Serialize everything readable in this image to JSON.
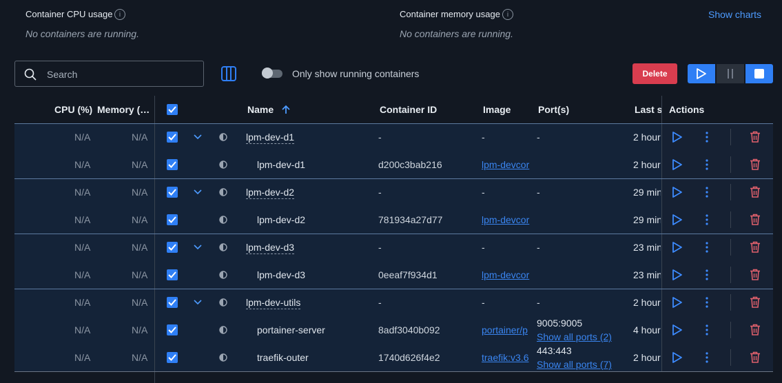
{
  "stats": {
    "cpu_title": "Container CPU usage",
    "cpu_empty": "No containers are running.",
    "mem_title": "Container memory usage",
    "mem_empty": "No containers are running.",
    "info_icon": "i",
    "show_charts": "Show charts"
  },
  "toolbar": {
    "search_placeholder": "Search",
    "running_only_label": "Only show running containers",
    "delete_label": "Delete"
  },
  "columns": {
    "cpu": "CPU (%)",
    "memory": "Memory (…",
    "name": "Name",
    "container_id": "Container ID",
    "image": "Image",
    "ports": "Port(s)",
    "last_started": "Last s",
    "actions": "Actions"
  },
  "rows": [
    {
      "cpu": "N/A",
      "mem": "N/A",
      "name": "lpm-dev-d1",
      "id": "-",
      "image": "-",
      "ports": "-",
      "last": "2 hour",
      "group": true
    },
    {
      "cpu": "N/A",
      "mem": "N/A",
      "name": "lpm-dev-d1",
      "id": "d200c3bab216",
      "image": "lpm-devcor",
      "ports": "",
      "last": "2 hour",
      "group": false
    },
    {
      "cpu": "N/A",
      "mem": "N/A",
      "name": "lpm-dev-d2",
      "id": "-",
      "image": "-",
      "ports": "-",
      "last": "29 min",
      "group": true
    },
    {
      "cpu": "N/A",
      "mem": "N/A",
      "name": "lpm-dev-d2",
      "id": "781934a27d77",
      "image": "lpm-devcor",
      "ports": "",
      "last": "29 min",
      "group": false
    },
    {
      "cpu": "N/A",
      "mem": "N/A",
      "name": "lpm-dev-d3",
      "id": "-",
      "image": "-",
      "ports": "-",
      "last": "23 min",
      "group": true
    },
    {
      "cpu": "N/A",
      "mem": "N/A",
      "name": "lpm-dev-d3",
      "id": "0eeaf7f934d1",
      "image": "lpm-devcor",
      "ports": "",
      "last": "23 min",
      "group": false
    },
    {
      "cpu": "N/A",
      "mem": "N/A",
      "name": "lpm-dev-utils",
      "id": "-",
      "image": "-",
      "ports": "-",
      "last": "2 hour",
      "group": true
    },
    {
      "cpu": "N/A",
      "mem": "N/A",
      "name": "portainer-server",
      "id": "8adf3040b092",
      "image": "portainer/p",
      "ports": "9005:9005",
      "ports_link": "Show all ports (2)",
      "last": "4 hour",
      "group": false
    },
    {
      "cpu": "N/A",
      "mem": "N/A",
      "name": "traefik-outer",
      "id": "1740d626f4e2",
      "image": "traefik:v3.6",
      "ports": "443:443",
      "ports_link": "Show all ports (7)",
      "last": "2 hour",
      "group": false
    }
  ],
  "colors": {
    "accent": "#2f7ff5",
    "delete": "#d93d4f",
    "trash": "#e0606c",
    "background": "#121822"
  }
}
